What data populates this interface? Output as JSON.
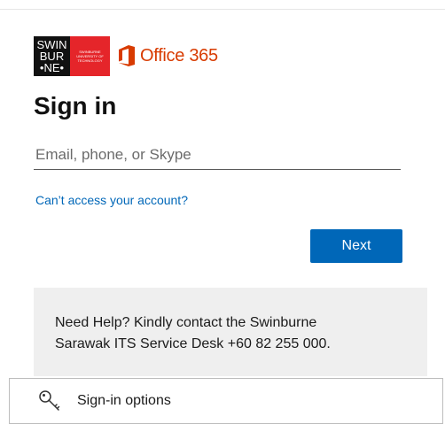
{
  "logo": {
    "swinburne_lines": [
      "SWIN",
      "BUR",
      "•NE•"
    ],
    "swinburne_sub": [
      "SWINBURNE",
      "UNIVERSITY OF",
      "TECHNOLOGY"
    ],
    "office_text": "Office 365"
  },
  "title": "Sign in",
  "email": {
    "placeholder": "Email, phone, or Skype",
    "value": ""
  },
  "cant_access_label": "Can’t access your account?",
  "next_label": "Next",
  "help": {
    "line1": "Need Help? Kindly contact the Swinburne",
    "line2": "Sarawak ITS Service Desk +60 82 255 000."
  },
  "signin_options_label": "Sign-in options",
  "colors": {
    "accent": "#0067b8",
    "office_orange": "#d83b01",
    "swinburne_red": "#e5252a"
  }
}
